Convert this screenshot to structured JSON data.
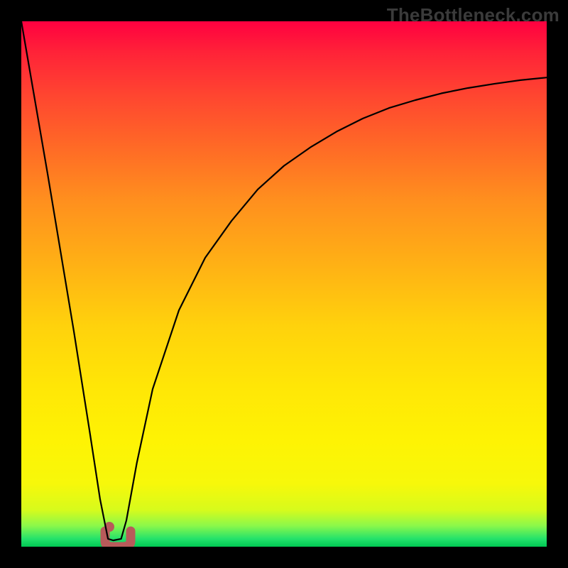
{
  "watermark": "TheBottleneck.com",
  "chart_data": {
    "type": "line",
    "title": "",
    "xlabel": "",
    "ylabel": "",
    "xlim": [
      0,
      100
    ],
    "ylim": [
      0,
      100
    ],
    "grid": false,
    "legend": false,
    "series": [
      {
        "name": "bottleneck-curve",
        "color": "#000000",
        "x": [
          0,
          5,
          10,
          13,
          15,
          16.5,
          17.5,
          19,
          20,
          22,
          25,
          30,
          35,
          40,
          45,
          50,
          55,
          60,
          65,
          70,
          75,
          80,
          85,
          90,
          95,
          100
        ],
        "values": [
          100,
          71,
          41,
          22,
          9,
          1.5,
          1.2,
          1.5,
          5,
          16,
          30,
          45,
          55,
          62,
          68,
          72.5,
          76,
          79,
          81.5,
          83.5,
          85,
          86.3,
          87.3,
          88.1,
          88.8,
          89.3
        ]
      }
    ],
    "marker": {
      "name": "bottleneck-minimum-marker",
      "color": "#b85a5a",
      "x": 17.5,
      "y": 1.2,
      "shape": "U"
    },
    "background_gradient": {
      "direction": "top-to-bottom",
      "stops": [
        {
          "pos": 0,
          "color": "#ff0040"
        },
        {
          "pos": 50,
          "color": "#ffb400"
        },
        {
          "pos": 82,
          "color": "#fef304"
        },
        {
          "pos": 100,
          "color": "#00c853"
        }
      ]
    }
  }
}
